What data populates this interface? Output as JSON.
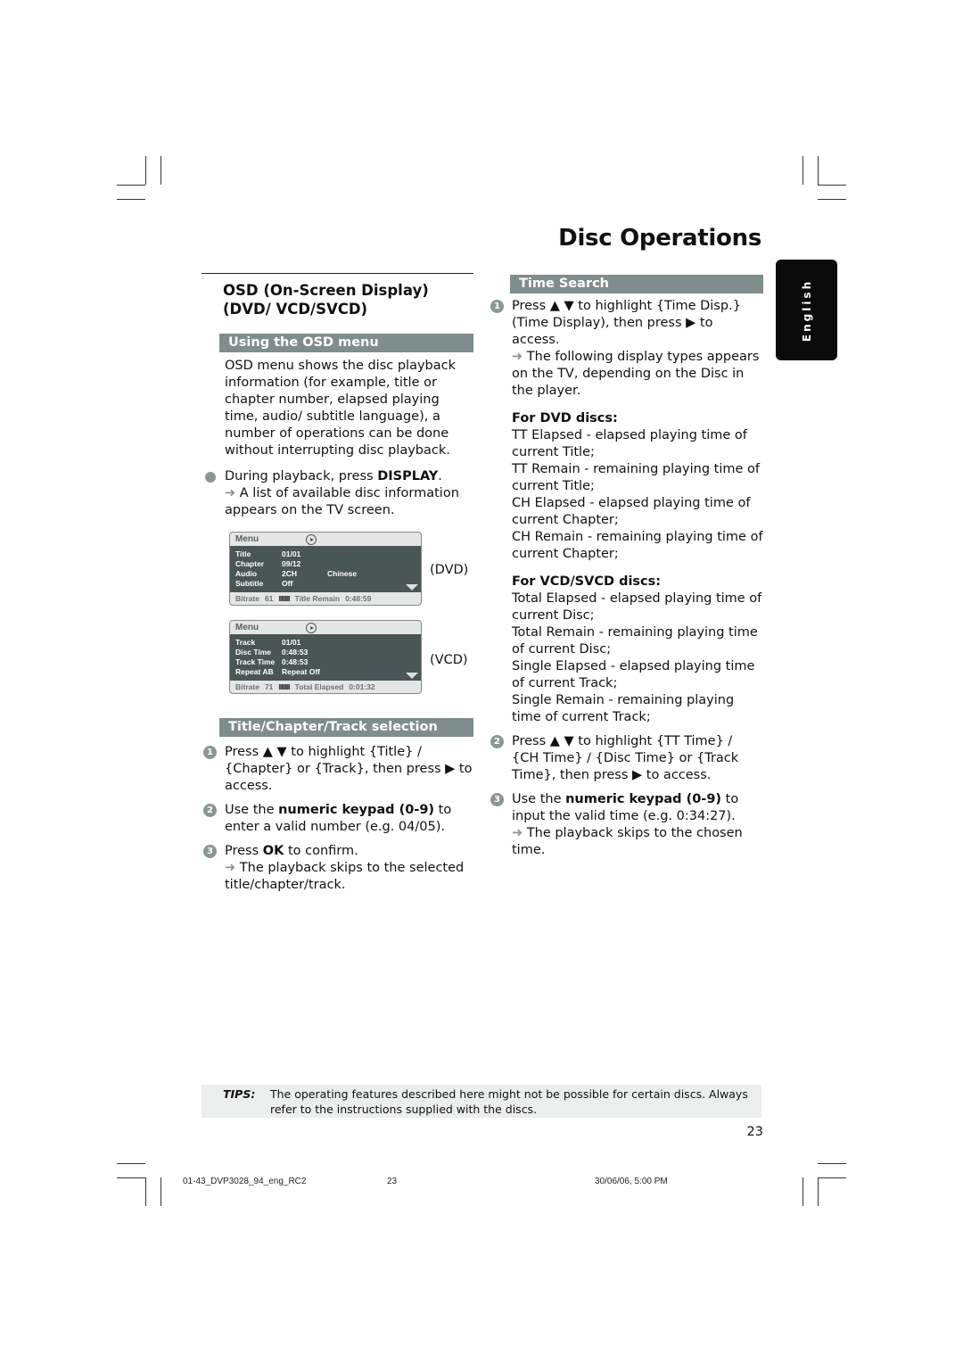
{
  "page": {
    "title": "Disc Operations",
    "language_tab": "English",
    "page_number": "23"
  },
  "left": {
    "heading": "OSD (On-Screen Display) (DVD/ VCD/SVCD)",
    "osd_section": {
      "band": "Using the OSD menu",
      "intro": "OSD menu shows the disc playback information (for example, title or chapter number, elapsed playing time, audio/ subtitle language), a number of operations can be done without interrupting disc playback.",
      "bullet_pre": "During playback, press ",
      "bullet_key": "DISPLAY",
      "bullet_post": ".",
      "bullet_result": "A list of available disc information appears on the TV screen."
    },
    "osd_dvd": {
      "header": "Menu",
      "rows": [
        {
          "k": "Title",
          "v": "01/01",
          "x": ""
        },
        {
          "k": "Chapter",
          "v": "09/12",
          "x": ""
        },
        {
          "k": "Audio",
          "v": "2CH",
          "x": "Chinese"
        },
        {
          "k": "Subtitle",
          "v": "Off",
          "x": ""
        }
      ],
      "footer": {
        "bitrate_label": "Bitrate",
        "bitrate": "61",
        "bars": "IIIIIIIII",
        "time_label": "Title Remain",
        "time": "0:48:59"
      },
      "caption": "(DVD)"
    },
    "osd_vcd": {
      "header": "Menu",
      "rows": [
        {
          "k": "Track",
          "v": "01/01",
          "x": ""
        },
        {
          "k": "Disc Time",
          "v": "0:48:53",
          "x": ""
        },
        {
          "k": "Track Time",
          "v": "0:48:53",
          "x": ""
        },
        {
          "k": "Repeat AB",
          "v": "Repeat Off",
          "x": ""
        }
      ],
      "footer": {
        "bitrate_label": "Bitrate",
        "bitrate": "71",
        "bars": "IIIIIIIII",
        "time_label": "Total Elapsed",
        "time": "0:01:32"
      },
      "caption": "(VCD)"
    },
    "selection": {
      "band": "Title/Chapter/Track selection",
      "step1_num": "1",
      "step1": "Press ▲ ▼ to highlight {Title} / {Chapter} or {Track}, then press ▶ to access.",
      "step2_num": "2",
      "step2_pre": "Use the ",
      "step2_key": "numeric keypad (0-9)",
      "step2_post": " to enter a valid number (e.g. 04/05).",
      "step3_num": "3",
      "step3_pre": "Press ",
      "step3_key": "OK",
      "step3_post": " to confirm.",
      "step3_result": "The playback skips to the selected title/chapter/track."
    }
  },
  "right": {
    "band": "Time Search",
    "step1_num": "1",
    "step1": "Press ▲ ▼ to highlight {Time Disp.} (Time Display), then press ▶ to access.",
    "step1_result": "The following display types appears on the TV, depending on the Disc in the player.",
    "dvd_heading": "For DVD discs:",
    "dvd_items": [
      "TT Elapsed - elapsed playing time of current Title;",
      "TT Remain - remaining playing time of current Title;",
      "CH Elapsed - elapsed playing time of current Chapter;",
      "CH Remain - remaining playing time of current Chapter;"
    ],
    "vcd_heading": "For VCD/SVCD discs:",
    "vcd_items": [
      "Total Elapsed - elapsed playing time of current Disc;",
      "Total Remain - remaining playing time of current Disc;",
      "Single Elapsed - elapsed playing time of current Track;",
      "Single Remain - remaining playing time of current Track;"
    ],
    "step2_num": "2",
    "step2": "Press ▲ ▼ to highlight {TT Time} / {CH Time} / {Disc Time} or {Track Time}, then press ▶ to access.",
    "step3_num": "3",
    "step3_pre": "Use the ",
    "step3_key": "numeric keypad (0-9)",
    "step3_post": " to input the valid time (e.g. 0:34:27).",
    "step3_result": "The playback skips to the chosen time."
  },
  "tips": {
    "label": "TIPS:",
    "text": "The operating features described here might not be possible for certain discs.  Always refer to the instructions supplied with the discs."
  },
  "footer": {
    "file": "01-43_DVP3028_94_eng_RC2",
    "page": "23",
    "timestamp": "30/06/06, 5:00 PM"
  },
  "arrow_glyph": "➜"
}
